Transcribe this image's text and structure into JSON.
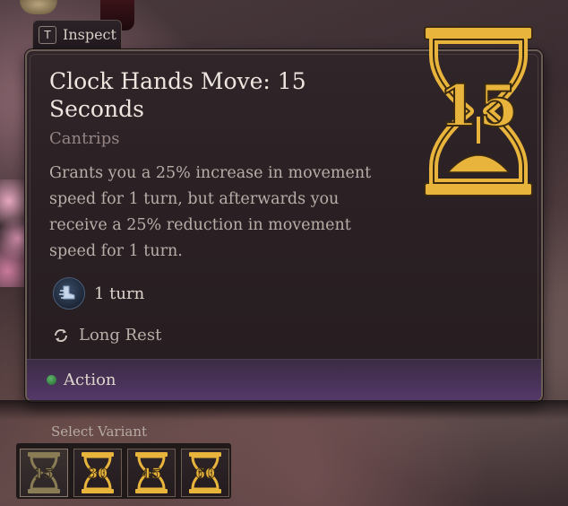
{
  "inspect": {
    "key": "T",
    "label": "Inspect"
  },
  "spell": {
    "title": "Clock Hands Move: 15 Seconds",
    "category": "Cantrips",
    "description": "Grants you a 25% increase in movement speed for 1 turn, but afterwards you receive a 25% reduction in movement speed for 1 turn.",
    "icon_number": "15",
    "duration": "1 turn",
    "recharge": "Long Rest",
    "cost": "Action"
  },
  "variants": {
    "label": "Select Variant",
    "items": [
      {
        "number": "15",
        "selected": true
      },
      {
        "number": "30",
        "selected": false
      },
      {
        "number": "45",
        "selected": false
      },
      {
        "number": "60",
        "selected": false
      }
    ]
  },
  "colors": {
    "gold": "#e8b43c",
    "gold_dark": "#3a2a12",
    "action_green": "#3f9a4e",
    "panel_bg": "#2b2125",
    "action_bar": "#4a335a"
  },
  "icons": {
    "hourglass": "hourglass-icon",
    "duration": "boot-dash-icon",
    "recharge": "refresh-icon",
    "action": "green-dot-icon"
  }
}
